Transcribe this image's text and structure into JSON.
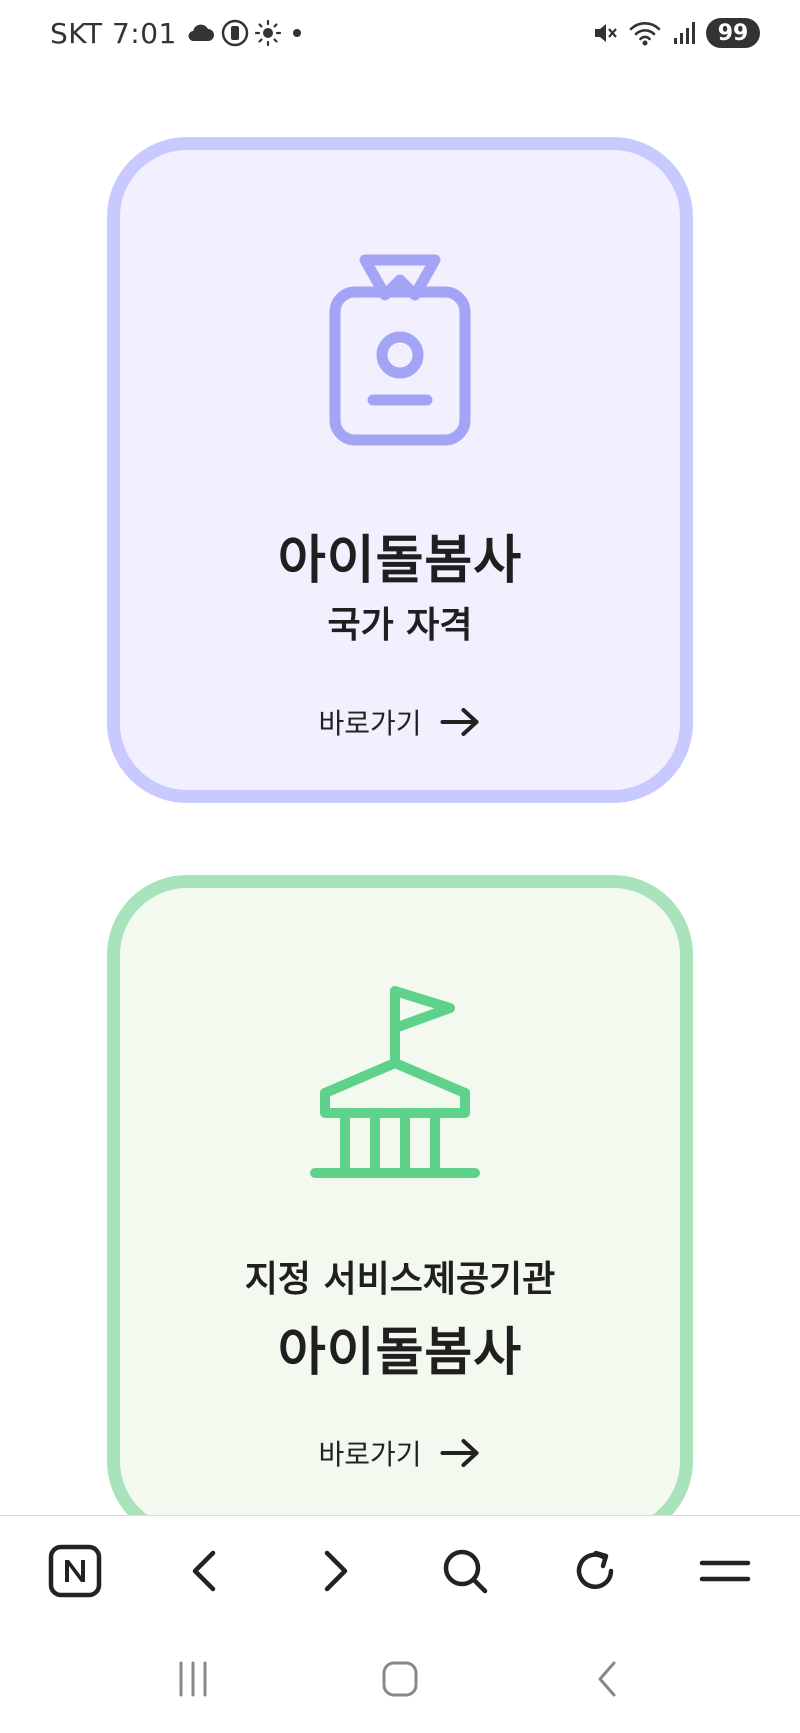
{
  "status_bar": {
    "carrier_time": "SKT 7:01",
    "battery": "99",
    "icons": [
      "cloud-icon",
      "vibrate-icon",
      "brightness-icon",
      "dot-icon",
      "mute-icon",
      "wifi-icon",
      "signal-icon"
    ]
  },
  "cards": [
    {
      "icon": "id-badge-icon",
      "line1": "아이돌봄사",
      "line2": "국가 자격",
      "link_label": "바로가기",
      "accent": "#a3a4f5"
    },
    {
      "icon": "institution-flag-icon",
      "line1": "지정 서비스제공기관",
      "line2": "아이돌봄사",
      "link_label": "바로가기",
      "accent": "#5ed28a"
    }
  ],
  "toolbar": {
    "items": [
      "naver-home-icon",
      "back-icon",
      "forward-icon",
      "search-icon",
      "refresh-icon",
      "menu-icon"
    ]
  },
  "system_nav": {
    "items": [
      "recent-apps-icon",
      "home-icon",
      "back-nav-icon"
    ]
  }
}
